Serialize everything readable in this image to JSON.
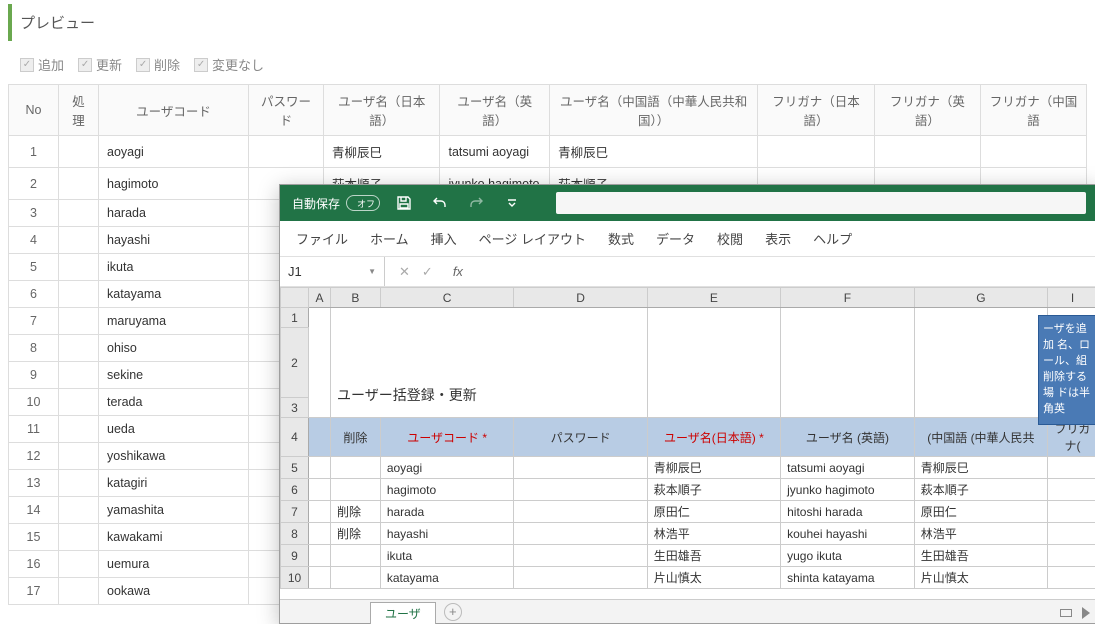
{
  "preview": {
    "title": "プレビュー"
  },
  "filters": {
    "add": "追加",
    "update": "更新",
    "delete": "削除",
    "nochange": "変更なし"
  },
  "table": {
    "headers": {
      "no": "No",
      "proc": "処理",
      "usercode": "ユーザコード",
      "password": "パスワード",
      "name_ja": "ユーザ名（日本語）",
      "name_en": "ユーザ名（英語）",
      "name_zh": "ユーザ名（中国語（中華人民共和国））",
      "furi_ja": "フリガナ（日本語）",
      "furi_en": "フリガナ（英語）",
      "furi_zh": "フリガナ（中国語"
    },
    "rows": [
      {
        "no": "1",
        "code": "aoyagi",
        "ja": "青柳辰巳",
        "en": "tatsumi aoyagi",
        "zh": "青柳辰巳"
      },
      {
        "no": "2",
        "code": "hagimoto",
        "ja": "萩本順子",
        "en": "jyunko hagimoto",
        "zh": "萩本順子"
      },
      {
        "no": "3",
        "code": "harada"
      },
      {
        "no": "4",
        "code": "hayashi"
      },
      {
        "no": "5",
        "code": "ikuta"
      },
      {
        "no": "6",
        "code": "katayama"
      },
      {
        "no": "7",
        "code": "maruyama"
      },
      {
        "no": "8",
        "code": "ohiso"
      },
      {
        "no": "9",
        "code": "sekine"
      },
      {
        "no": "10",
        "code": "terada"
      },
      {
        "no": "11",
        "code": "ueda"
      },
      {
        "no": "12",
        "code": "yoshikawa"
      },
      {
        "no": "13",
        "code": "katagiri"
      },
      {
        "no": "14",
        "code": "yamashita"
      },
      {
        "no": "15",
        "code": "kawakami"
      },
      {
        "no": "16",
        "code": "uemura"
      },
      {
        "no": "17",
        "code": "ookawa"
      }
    ]
  },
  "excel": {
    "autosave_label": "自動保存",
    "autosave_state": "オフ",
    "tabs": {
      "file": "ファイル",
      "home": "ホーム",
      "insert": "挿入",
      "layout": "ページ レイアウト",
      "formula": "数式",
      "data": "データ",
      "review": "校閲",
      "view": "表示",
      "help": "ヘルプ"
    },
    "namebox": "J1",
    "fx": "fx",
    "merged_title": "ユーザー括登録・更新",
    "cols": {
      "A": "A",
      "B": "B",
      "C": "C",
      "D": "D",
      "E": "E",
      "F": "F",
      "G": "G",
      "I": "I"
    },
    "hdr": {
      "delete": "削除",
      "usercode": "ユーザコード *",
      "password": "パスワード",
      "name_ja": "ユーザ名(日本語) *",
      "name_en": "ユーザ名 (英語)",
      "name_zh": "(中国語 (中華人民共",
      "furi": "フリガナ("
    },
    "rows": [
      {
        "n": "5",
        "b": "",
        "c": "aoyagi",
        "d": "",
        "e": "青柳辰巳",
        "f": "tatsumi aoyagi",
        "g": "青柳辰巳"
      },
      {
        "n": "6",
        "b": "",
        "c": "hagimoto",
        "d": "",
        "e": "萩本順子",
        "f": "jyunko hagimoto",
        "g": "萩本順子"
      },
      {
        "n": "7",
        "b": "削除",
        "c": "harada",
        "d": "",
        "e": "原田仁",
        "f": "hitoshi harada",
        "g": "原田仁"
      },
      {
        "n": "8",
        "b": "削除",
        "c": "hayashi",
        "d": "",
        "e": "林浩平",
        "f": "kouhei hayashi",
        "g": "林浩平"
      },
      {
        "n": "9",
        "b": "",
        "c": "ikuta",
        "d": "",
        "e": "生田雄吾",
        "f": "yugo ikuta",
        "g": "生田雄吾"
      },
      {
        "n": "10",
        "b": "",
        "c": "katayama",
        "d": "",
        "e": "片山慎太",
        "f": "shinta katayama",
        "g": "片山慎太"
      }
    ],
    "comment": "ーザを追加\n名、ロール、組\n削除する場\nドは半角英",
    "sheet_tab": "ユーザ"
  }
}
